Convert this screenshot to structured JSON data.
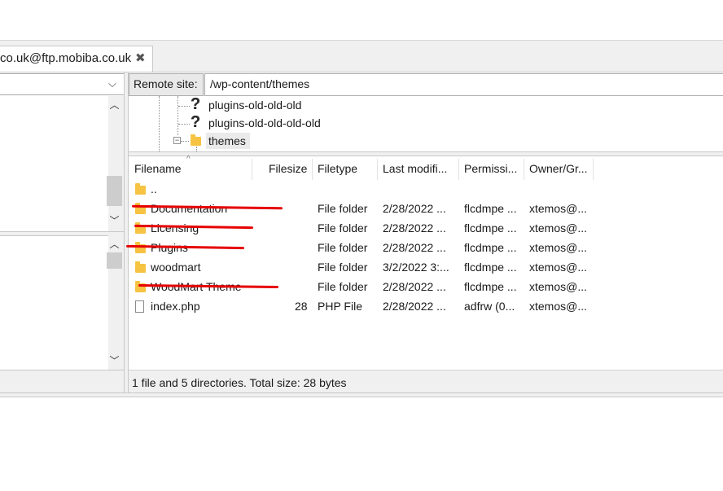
{
  "tab": {
    "label": "co.uk@ftp.mobiba.co.uk",
    "close_glyph": "✖"
  },
  "left_pane": {
    "dropdown_arrow": "⌵"
  },
  "remote": {
    "label": "Remote site:",
    "path": "/wp-content/themes"
  },
  "tree": {
    "items": [
      {
        "label": "plugins-old-old-old",
        "icon": "unknown-folder-icon"
      },
      {
        "label": "plugins-old-old-old-old",
        "icon": "unknown-folder-icon"
      },
      {
        "label": "themes",
        "icon": "folder-icon",
        "expanded": true,
        "selected": true
      }
    ],
    "expander_glyph": "−"
  },
  "filelist": {
    "columns": [
      "Filename",
      "Filesize",
      "Filetype",
      "Last modifi...",
      "Permissi...",
      "Owner/Gr..."
    ],
    "sort_indicator": "^",
    "rows": [
      {
        "name": "..",
        "size": "",
        "type": "",
        "modified": "",
        "perms": "",
        "owner": "",
        "icon": "folder-icon",
        "struck": false
      },
      {
        "name": "Documentation",
        "size": "",
        "type": "File folder",
        "modified": "2/28/2022 ...",
        "perms": "flcdmpe ...",
        "owner": "xtemos@...",
        "icon": "folder-icon",
        "struck": true
      },
      {
        "name": "Licensing",
        "size": "",
        "type": "File folder",
        "modified": "2/28/2022 ...",
        "perms": "flcdmpe ...",
        "owner": "xtemos@...",
        "icon": "folder-icon",
        "struck": true
      },
      {
        "name": "Plugins",
        "size": "",
        "type": "File folder",
        "modified": "2/28/2022 ...",
        "perms": "flcdmpe ...",
        "owner": "xtemos@...",
        "icon": "folder-icon",
        "struck": true
      },
      {
        "name": "woodmart",
        "size": "",
        "type": "File folder",
        "modified": "3/2/2022 3:...",
        "perms": "flcdmpe ...",
        "owner": "xtemos@...",
        "icon": "folder-icon",
        "struck": false
      },
      {
        "name": "WoodMart Theme",
        "size": "",
        "type": "File folder",
        "modified": "2/28/2022 ...",
        "perms": "flcdmpe ...",
        "owner": "xtemos@...",
        "icon": "folder-icon",
        "struck": true
      },
      {
        "name": "index.php",
        "size": "28",
        "type": "PHP File",
        "modified": "2/28/2022 ...",
        "perms": "adfrw (0...",
        "owner": "xtemos@...",
        "icon": "file-icon",
        "struck": false
      }
    ]
  },
  "status": {
    "text": "1 file and 5 directories. Total size: 28 bytes"
  },
  "scroll_glyphs": {
    "up": "︿",
    "down": "﹀"
  },
  "colors": {
    "folder": "#f6c342",
    "strike": "#e60000",
    "chrome": "#f0f0f0"
  }
}
